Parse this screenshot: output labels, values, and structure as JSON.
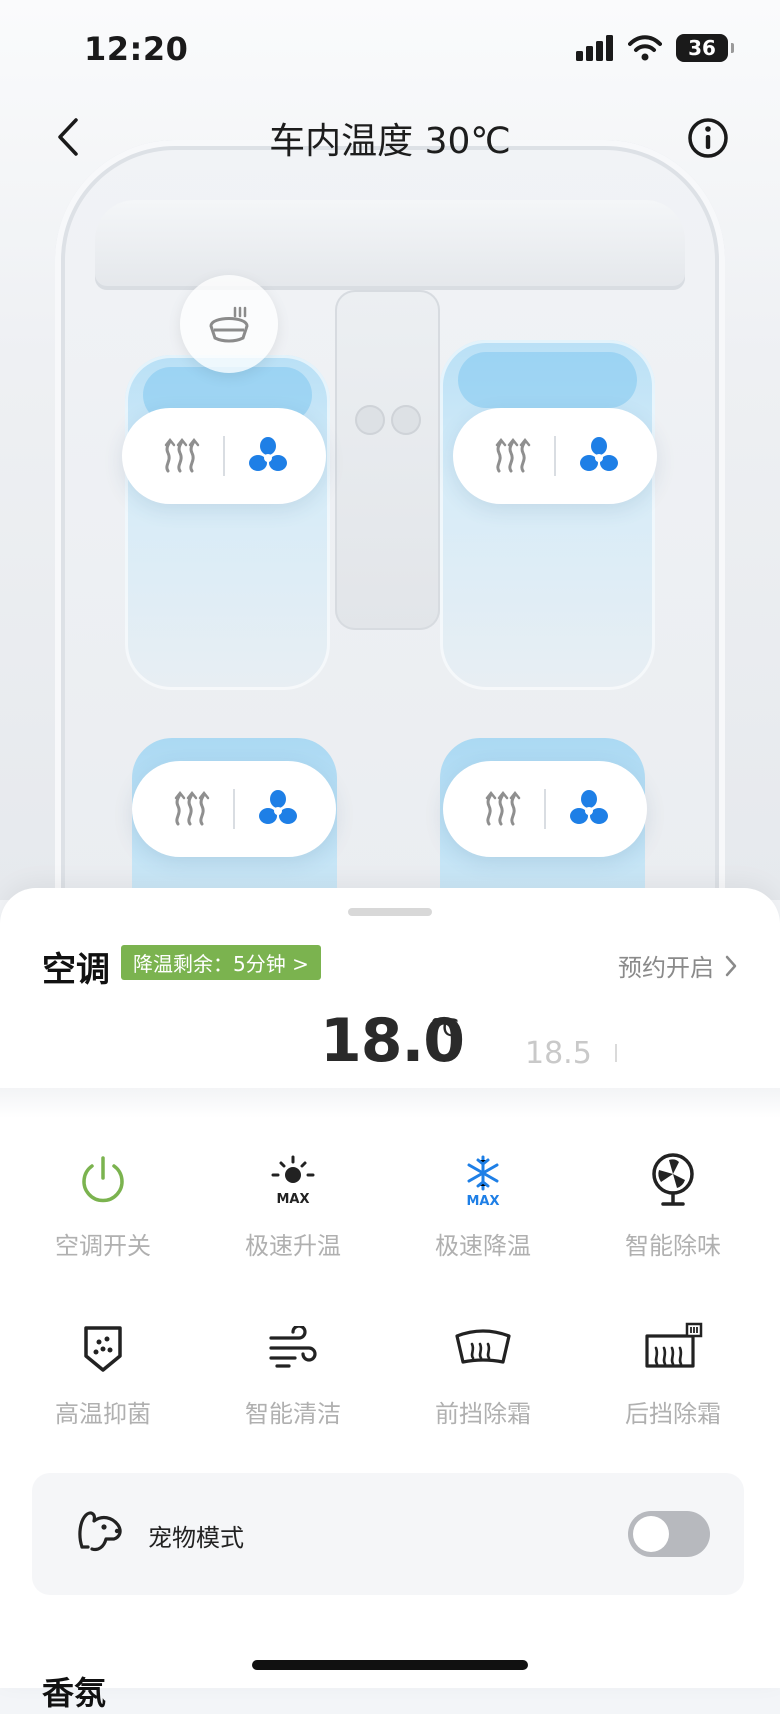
{
  "status_bar": {
    "time": "12:20",
    "battery": "36"
  },
  "header": {
    "title": "车内温度 30℃"
  },
  "ac": {
    "title": "空调",
    "badge": "降温剩余：5分钟 >",
    "schedule": "预约开启",
    "temperature": "18.0",
    "unit": "°C",
    "next_temperature": "18.5"
  },
  "controls": [
    {
      "label": "空调开关",
      "icon": "power-icon",
      "color": "#7bb34f"
    },
    {
      "label": "极速升温",
      "icon": "sun-max-icon",
      "color": "#222222"
    },
    {
      "label": "极速降温",
      "icon": "snowflake-max-icon",
      "color": "#1e7fe6"
    },
    {
      "label": "智能除味",
      "icon": "fan-deodorize-icon",
      "color": "#222222"
    },
    {
      "label": "高温抑菌",
      "icon": "shield-dots-icon",
      "color": "#222222"
    },
    {
      "label": "智能清洁",
      "icon": "wind-icon",
      "color": "#222222"
    },
    {
      "label": "前挡除霜",
      "icon": "front-defrost-icon",
      "color": "#222222"
    },
    {
      "label": "后挡除霜",
      "icon": "rear-defrost-icon",
      "color": "#222222"
    }
  ],
  "pet_mode": {
    "label": "宠物模式",
    "enabled": false
  },
  "fragrance": {
    "title": "香氛"
  },
  "colors": {
    "accent_blue": "#1e7fe6",
    "badge_green": "#7bb34f",
    "seat_blue": "#b9e0f6"
  }
}
